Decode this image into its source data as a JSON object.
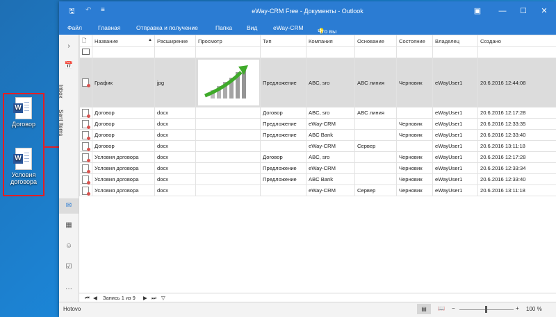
{
  "desktop": {
    "icons": [
      {
        "label": "Договор",
        "icon": "word-doc-icon"
      },
      {
        "label": "Условия договора",
        "icon": "word-doc-icon"
      }
    ]
  },
  "window": {
    "title": "eWay-CRM Free - Документы - Outlook",
    "accent": "#2b7cd3",
    "menu": [
      "Файл",
      "Главная",
      "Отправка и получение",
      "Папка",
      "Вид",
      "eWay-CRM"
    ],
    "search_placeholder": "Что вы хотите сделать?"
  },
  "nav": {
    "folders": [
      "Inbox",
      "Sent Items"
    ],
    "icons": [
      "mail-icon",
      "calendar-icon",
      "people-icon",
      "tasks-icon",
      "more-icon"
    ]
  },
  "table": {
    "columns": [
      "Название",
      "Расширение",
      "Просмотр",
      "Тип",
      "Компания",
      "Основание",
      "Состояние",
      "Владелец",
      "Создано"
    ],
    "rows": [
      [
        "График",
        "jpg",
        "",
        "Предложение",
        "ABC, sro",
        "ABC линия",
        "Черновик",
        "eWayUser1",
        "20.6.2016 12:44:08"
      ],
      [
        "Договор",
        "docx",
        "",
        "Договор",
        "ABC, sro",
        "ABC линия",
        "",
        "eWayUser1",
        "20.6.2016 12:17:28"
      ],
      [
        "Договор",
        "docx",
        "",
        "Предложение",
        "eWay-CRM",
        "",
        "Черновик",
        "eWayUser1",
        "20.6.2016 12:33:35"
      ],
      [
        "Договор",
        "docx",
        "",
        "Предложение",
        "ABC Bank",
        "",
        "Черновик",
        "eWayUser1",
        "20.6.2016 12:33:40"
      ],
      [
        "Договор",
        "docx",
        "",
        "",
        "eWay-CRM",
        "Сервер",
        "",
        "eWayUser1",
        "20.6.2016 13:11:18"
      ],
      [
        "Условия договора",
        "docx",
        "",
        "Договор",
        "ABC, sro",
        "",
        "Черновик",
        "eWayUser1",
        "20.6.2016 12:17:28"
      ],
      [
        "Условия договора",
        "docx",
        "",
        "Предложение",
        "eWay-CRM",
        "",
        "Черновик",
        "eWayUser1",
        "20.6.2016 12:33:34"
      ],
      [
        "Условия договора",
        "docx",
        "",
        "Предложение",
        "ABC Bank",
        "",
        "Черновик",
        "eWayUser1",
        "20.6.2016 12:33:40"
      ],
      [
        "Условия договора",
        "docx",
        "",
        "",
        "eWay-CRM",
        "Сервер",
        "Черновик",
        "eWayUser1",
        "20.6.2016 13:11:18"
      ]
    ]
  },
  "pager": {
    "label": "Запись 1 из 9"
  },
  "status": {
    "text": "Hotovo",
    "zoom": "100 %"
  }
}
